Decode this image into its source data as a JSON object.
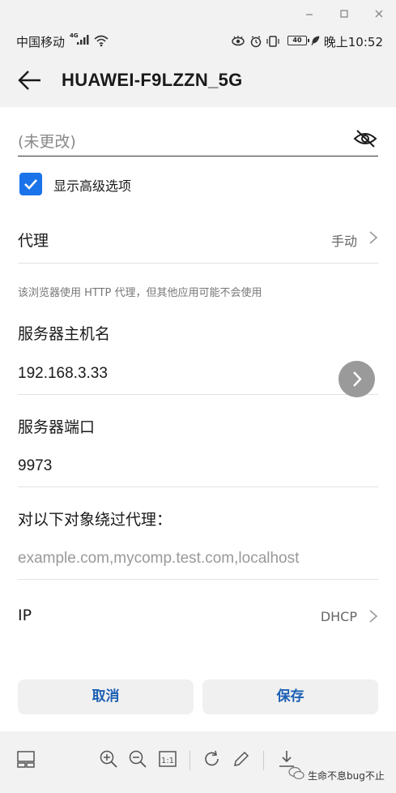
{
  "window": {
    "minimize_icon": "minimize-icon",
    "maximize_icon": "maximize-icon",
    "close_icon": "close-icon"
  },
  "status": {
    "carrier": "中国移动",
    "network": "4G",
    "battery": "40",
    "time": "晚上10:52"
  },
  "header": {
    "title": "HUAWEI-F9LZZN_5G"
  },
  "form": {
    "password_value": "(未更改)",
    "show_advanced_label": "显示高级选项",
    "show_advanced_checked": true,
    "proxy_label": "代理",
    "proxy_value": "手动",
    "proxy_hint": "该浏览器使用 HTTP 代理，但其他应用可能不会使用",
    "host_label": "服务器主机名",
    "host_value": "192.168.3.33",
    "port_label": "服务器端口",
    "port_value": "9973",
    "bypass_label": "对以下对象绕过代理：",
    "bypass_placeholder": "example.com,mycomp.test.com,localhost",
    "ip_label": "IP",
    "ip_value": "DHCP"
  },
  "actions": {
    "cancel": "取消",
    "save": "保存"
  },
  "watermark": {
    "text": "生命不息bug不止"
  },
  "colors": {
    "accent": "#1a73e8",
    "button_text": "#1a5fb4",
    "fab": "#9a9a9a"
  }
}
